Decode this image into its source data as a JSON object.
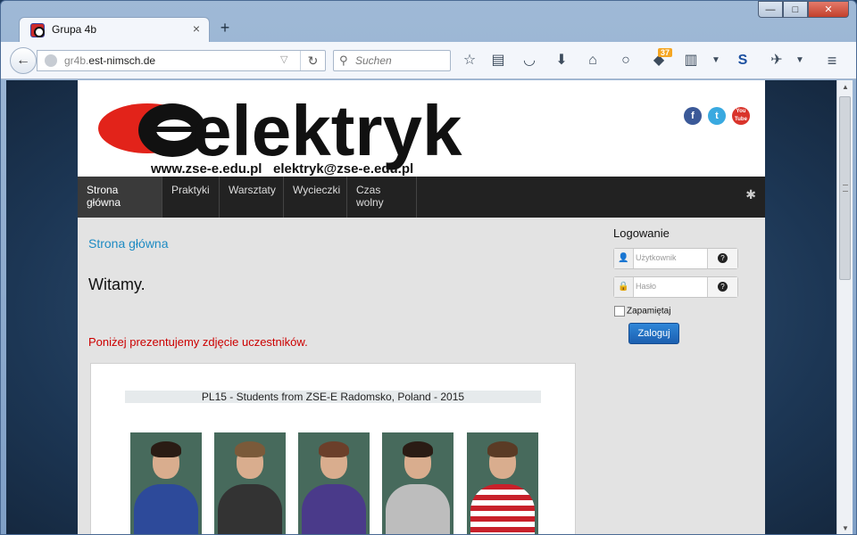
{
  "window": {
    "tab_title": "Grupa 4b",
    "tab_close": "×",
    "new_tab": "+",
    "controls": {
      "minimize": "—",
      "maximize": "□",
      "close": "✕"
    }
  },
  "toolbar": {
    "url_host_prefix": "gr4b.",
    "url_domain": "est-nimsch.de",
    "search_placeholder": "Suchen",
    "notification_count": "37"
  },
  "site": {
    "logo_text": "elektryk",
    "logo_line": "www.zse-e.edu.pl   elektryk@zse-e.edu.pl",
    "social": [
      "f",
      "t",
      "You Tube"
    ],
    "menu": [
      "Strona główna",
      "Praktyki",
      "Warsztaty",
      "Wycieczki",
      "Czas wolny"
    ],
    "breadcrumb": "Strona główna",
    "welcome": "Witamy.",
    "intro": "Poniżej prezentujemy zdjęcie uczestników.",
    "photo_caption": "PL15 - Students from ZSE-E Radomsko, Poland - 2015"
  },
  "login": {
    "title": "Logowanie",
    "username_placeholder": "Użytkownik",
    "password_placeholder": "Hasło",
    "remember_label": "Zapamiętaj",
    "submit_label": "Zaloguj"
  },
  "colors": {
    "menu_bg": "#222222",
    "link_blue": "#1e8bc3",
    "intro_red": "#cc0000",
    "logo_red": "#e2231a",
    "button_blue": "#1c5fb0"
  }
}
